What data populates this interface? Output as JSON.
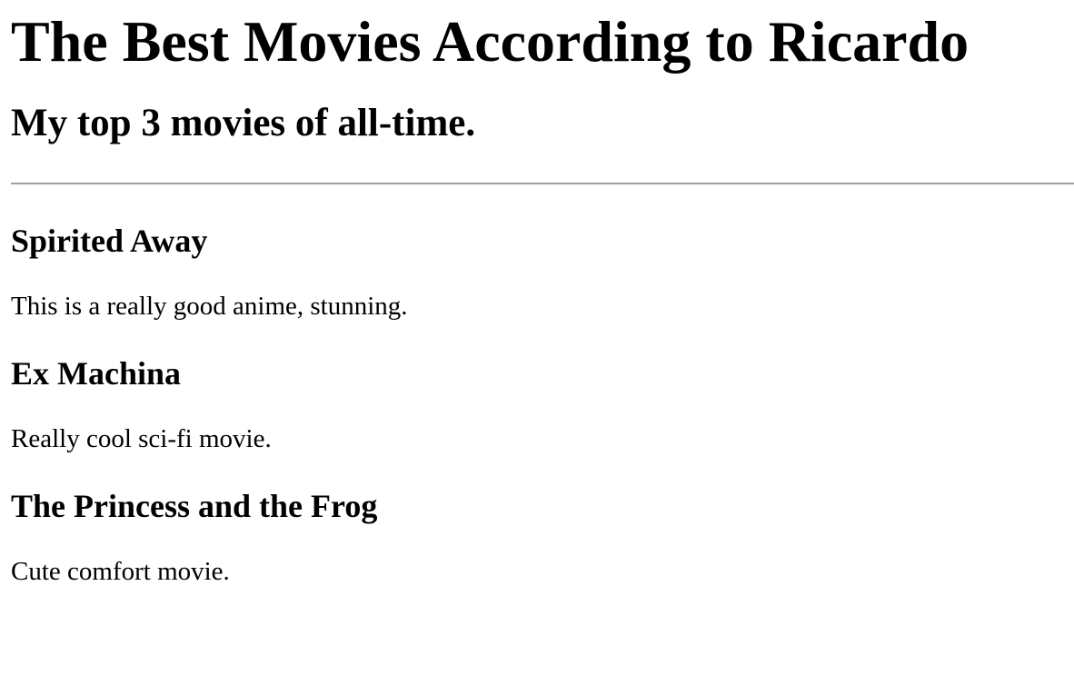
{
  "page": {
    "title": "The Best Movies According to Ricardo",
    "subtitle": "My top 3 movies of all-time."
  },
  "movies": [
    {
      "title": "Spirited Away",
      "description": "This is a really good anime, stunning."
    },
    {
      "title": "Ex Machina",
      "description": "Really cool sci-fi movie."
    },
    {
      "title": "The Princess and the Frog",
      "description": "Cute comfort movie."
    }
  ]
}
